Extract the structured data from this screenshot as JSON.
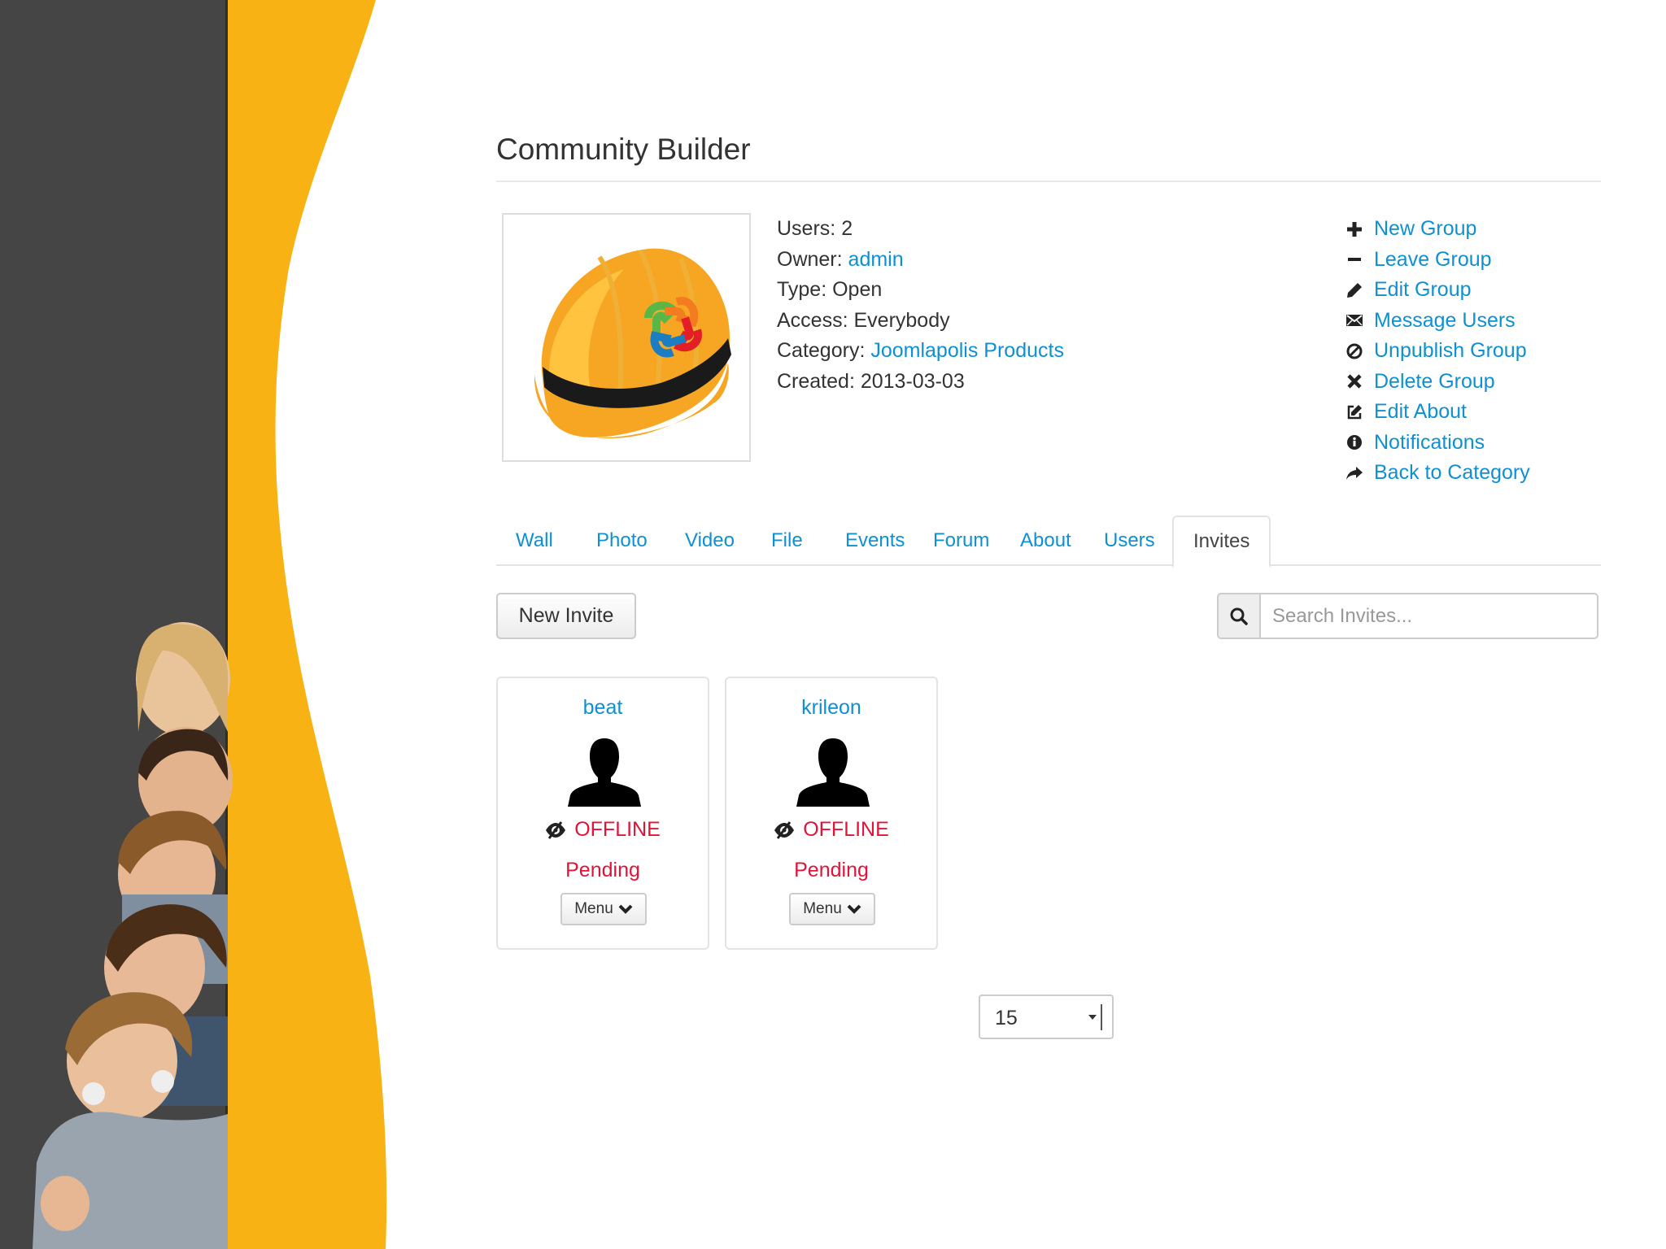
{
  "page": {
    "title": "Community Builder"
  },
  "group_info": {
    "users_label": "Users:",
    "users_value": "2",
    "owner_label": "Owner:",
    "owner_value": "admin",
    "type_label": "Type:",
    "type_value": "Open",
    "access_label": "Access:",
    "access_value": "Everybody",
    "category_label": "Category:",
    "category_value": "Joomlapolis Products",
    "created_label": "Created:",
    "created_value": "2013-03-03"
  },
  "actions": [
    {
      "label": "New Group",
      "icon": "plus-icon"
    },
    {
      "label": "Leave Group",
      "icon": "minus-icon"
    },
    {
      "label": "Edit Group",
      "icon": "pencil-icon"
    },
    {
      "label": "Message Users",
      "icon": "envelope-icon"
    },
    {
      "label": "Unpublish Group",
      "icon": "ban-icon"
    },
    {
      "label": "Delete Group",
      "icon": "times-icon"
    },
    {
      "label": "Edit About",
      "icon": "edit-icon"
    },
    {
      "label": "Notifications",
      "icon": "info-icon"
    },
    {
      "label": "Back to Category",
      "icon": "share-icon"
    }
  ],
  "tabs": [
    {
      "label": "Wall"
    },
    {
      "label": "Photo"
    },
    {
      "label": "Video"
    },
    {
      "label": "File"
    },
    {
      "label": "Events"
    },
    {
      "label": "Forum"
    },
    {
      "label": "About"
    },
    {
      "label": "Users"
    },
    {
      "label": "Invites",
      "active": true
    }
  ],
  "invites": {
    "new_button": "New Invite",
    "search_placeholder": "Search Invites...",
    "cards": [
      {
        "name": "beat",
        "status": "OFFLINE",
        "state": "Pending",
        "menu": "Menu"
      },
      {
        "name": "krileon",
        "status": "OFFLINE",
        "state": "Pending",
        "menu": "Menu"
      }
    ],
    "page_size": "15"
  },
  "colors": {
    "link": "#0e90d2",
    "offline": "#e0143a",
    "accent_yellow": "#f9b214",
    "dark_panel": "#454545"
  }
}
